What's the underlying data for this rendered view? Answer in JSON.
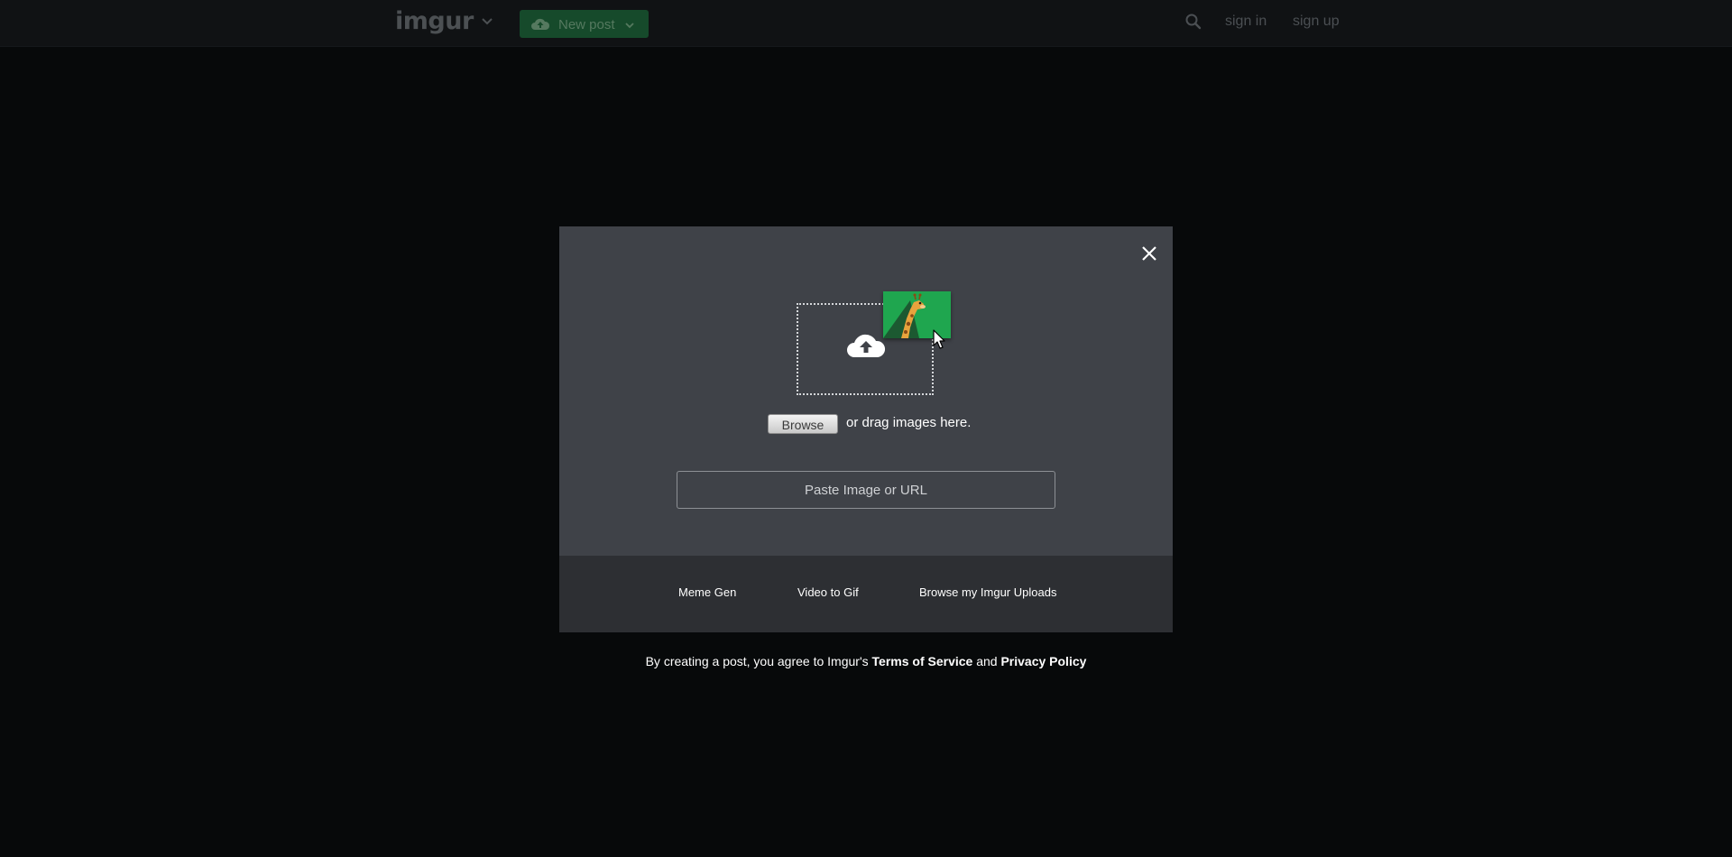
{
  "nav": {
    "logo": "imgur",
    "new_post_label": "New post",
    "sign_in": "sign in",
    "sign_up": "sign up"
  },
  "modal": {
    "browse_label": "Browse",
    "drag_text": "or drag images here.",
    "url_placeholder": "Paste Image or URL",
    "footer_links": [
      "Meme Gen",
      "Video to Gif",
      "Browse my Imgur Uploads"
    ]
  },
  "terms": {
    "prefix": "By creating a post, you agree to Imgur's",
    "tos": "Terms of Service",
    "and": "and",
    "privacy": "Privacy Policy"
  },
  "colors": {
    "background": "#07090a",
    "topbar": "#101214",
    "modal": "#3f4248",
    "modal_footer": "#2d2f33",
    "new_post": "#164a2b",
    "giraffe_card": "#1fa64f"
  },
  "icons": {
    "logo_chevron": "chevron-down-icon",
    "new_post_cloud": "cloud-upload-icon",
    "search": "search-icon",
    "close": "close-icon",
    "dropzone_cloud": "cloud-upload-icon",
    "giraffe": "giraffe-icon",
    "cursor": "cursor-icon"
  }
}
